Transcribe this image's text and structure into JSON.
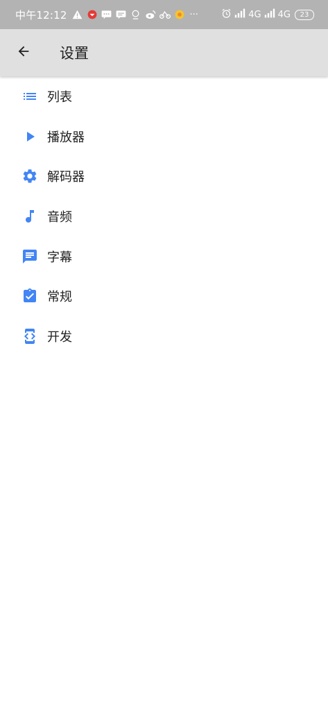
{
  "status_bar": {
    "time": "中午12:12",
    "network1": "4G",
    "network2": "4G",
    "battery": "23",
    "more": "···"
  },
  "app_bar": {
    "title": "设置"
  },
  "colors": {
    "accent": "#4285f4",
    "app_bar_bg": "#e0e0e0",
    "status_bar_bg": "#b3b3b3"
  },
  "menu": {
    "items": [
      {
        "label": "列表",
        "icon": "list-icon"
      },
      {
        "label": "播放器",
        "icon": "play-icon"
      },
      {
        "label": "解码器",
        "icon": "gear-icon"
      },
      {
        "label": "音频",
        "icon": "music-note-icon"
      },
      {
        "label": "字幕",
        "icon": "subtitle-icon"
      },
      {
        "label": "常规",
        "icon": "clipboard-check-icon"
      },
      {
        "label": "开发",
        "icon": "developer-mode-icon"
      }
    ]
  }
}
